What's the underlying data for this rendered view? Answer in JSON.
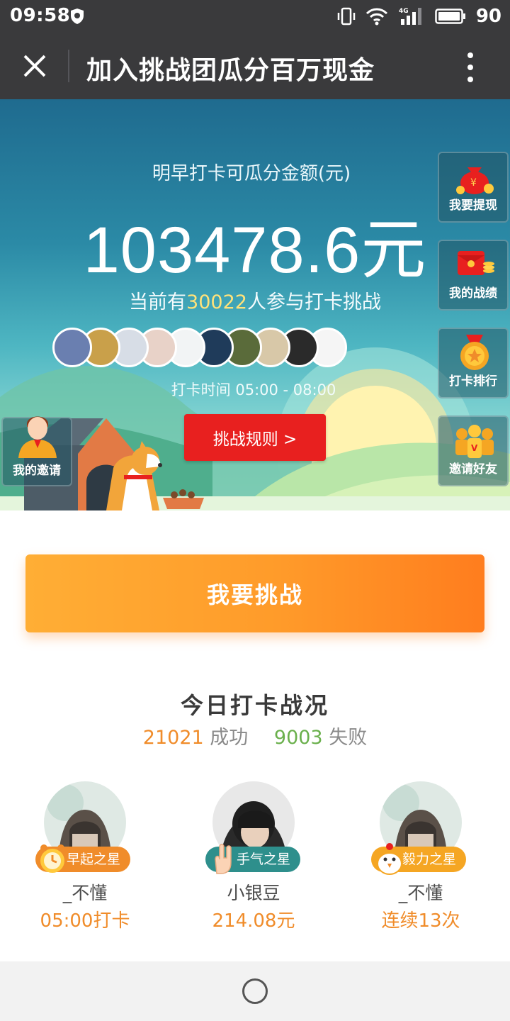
{
  "status_bar": {
    "time": "09:58",
    "battery": "90",
    "network": "4G"
  },
  "title_bar": {
    "title": "加入挑战团瓜分百万现金"
  },
  "hero": {
    "subtitle": "明早打卡可瓜分金额(元)",
    "amount": "103478.6元",
    "participants_prefix": "当前有",
    "participants_count": "30022",
    "participants_suffix": "人参与打卡挑战",
    "time_range": "打卡时间 05:00 - 08:00",
    "rules_button": "挑战规则 >",
    "invite_label": "我的邀请",
    "side_buttons": [
      {
        "label": "我要提现",
        "icon": "money-bag-icon"
      },
      {
        "label": "我的战绩",
        "icon": "red-envelope-icon"
      },
      {
        "label": "打卡排行",
        "icon": "medal-icon"
      },
      {
        "label": "邀请好友",
        "icon": "group-icon"
      }
    ],
    "avatar_colors": [
      "#6a7fb0",
      "#c9a04a",
      "#d7dde6",
      "#e8d2c8",
      "#f2f4f5",
      "#1f3b5a",
      "#5a6b3a",
      "#d8c8a8",
      "#2a2a2a",
      "#f5f5f5"
    ]
  },
  "main": {
    "challenge_button": "我要挑战",
    "section_title": "今日打卡战况",
    "success_count": "21021",
    "success_label": "成功",
    "fail_count": "9003",
    "fail_label": "失败"
  },
  "stars": [
    {
      "badge": "早起之星",
      "name": "_不懂",
      "value": "05:00打卡",
      "badge_color": "#f08c2a",
      "icon": "alarm-clock-icon"
    },
    {
      "badge": "手气之星",
      "name": "小银豆",
      "value": "214.08元",
      "badge_color": "#2e8f8c",
      "icon": "hand-icon"
    },
    {
      "badge": "毅力之星",
      "name": "_不懂",
      "value": "连续13次",
      "badge_color": "#f5a623",
      "icon": "chick-icon"
    }
  ],
  "colors": {
    "accent_orange": "#f08c2a",
    "success_green": "#6ab04c",
    "rules_red": "#e8201f",
    "title_bar": "#3a3a3c"
  }
}
